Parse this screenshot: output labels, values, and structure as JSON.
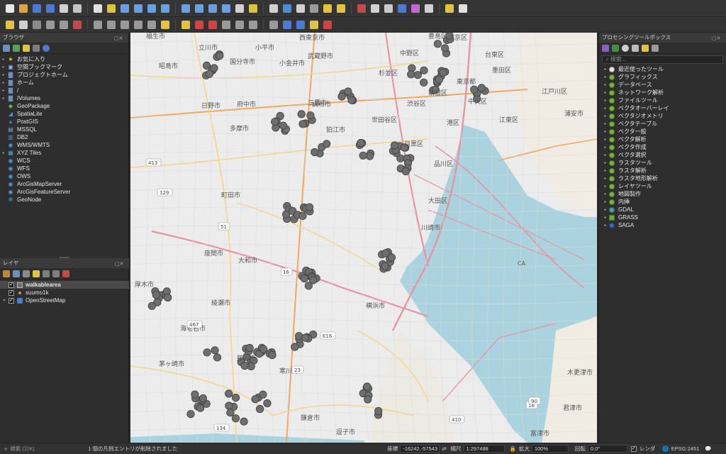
{
  "toolbar_row1": [
    "new-project-icon",
    "open-project-icon",
    "save-project-icon",
    "save-as-icon",
    "print-layout-icon",
    "style-manager-icon",
    "pan-icon",
    "pan-to-selection-icon",
    "zoom-in-icon",
    "zoom-out-icon",
    "zoom-full-icon",
    "zoom-to-selection-icon",
    "zoom-to-layer-icon",
    "zoom-native-icon",
    "zoom-last-icon",
    "zoom-next-icon",
    "new-map-view-icon",
    "new-bookmark-icon",
    "show-bookmarks-icon",
    "refresh-icon",
    "identify-icon",
    "measure-icon",
    "select-features-icon",
    "select-by-value-icon",
    "deselect-icon",
    "attribute-table-icon",
    "field-calculator-icon",
    "processing-toolbox-icon",
    "statistics-icon",
    "measure-line-icon",
    "annotation-icon",
    "text-annotation-icon"
  ],
  "toolbar_row2": [
    "digitize-icon",
    "edit-pencil-icon",
    "save-edits-icon",
    "add-feature-icon",
    "vertex-tool-icon",
    "delete-selected-icon",
    "cut-features-icon",
    "copy-features-icon",
    "paste-features-icon",
    "undo-icon",
    "redo-icon",
    "label-icon",
    "layer-labeling-icon",
    "highlight-pinned-icon",
    "pin-labels-icon",
    "show-hide-labels-icon",
    "move-label-icon",
    "rotate-label-icon",
    "change-label-icon",
    "layer-diagram-icon",
    "help-icon",
    "python-console-icon",
    "plugin-icon"
  ],
  "browser": {
    "title": "ブラウザ",
    "items": [
      {
        "label": "お気に入り",
        "icon": "star-icon",
        "expandable": true
      },
      {
        "label": "空間ブックマーク",
        "icon": "bookmark-icon",
        "expandable": true
      },
      {
        "label": "プロジェクトホーム",
        "icon": "folder-icon",
        "expandable": true
      },
      {
        "label": "ホーム",
        "icon": "folder-icon",
        "expandable": true
      },
      {
        "label": "/",
        "icon": "folder-icon",
        "expandable": true
      },
      {
        "label": "/Volumes",
        "icon": "folder-icon",
        "expandable": true
      },
      {
        "label": "GeoPackage",
        "icon": "geopackage-icon",
        "expandable": false
      },
      {
        "label": "SpatiaLite",
        "icon": "spatialite-icon",
        "expandable": false
      },
      {
        "label": "PostGIS",
        "icon": "postgis-icon",
        "expandable": false
      },
      {
        "label": "MSSQL",
        "icon": "mssql-icon",
        "expandable": false
      },
      {
        "label": "DB2",
        "icon": "db2-icon",
        "expandable": false
      },
      {
        "label": "WMS/WMTS",
        "icon": "wms-icon",
        "expandable": false
      },
      {
        "label": "XYZ Tiles",
        "icon": "xyz-tiles-icon",
        "expandable": true
      },
      {
        "label": "WCS",
        "icon": "wcs-icon",
        "expandable": false
      },
      {
        "label": "WFS",
        "icon": "wfs-icon",
        "expandable": false
      },
      {
        "label": "OWS",
        "icon": "ows-icon",
        "expandable": false
      },
      {
        "label": "ArcGisMapServer",
        "icon": "arcgis-icon",
        "expandable": false
      },
      {
        "label": "ArcGisFeatureServer",
        "icon": "arcgis-icon",
        "expandable": false
      },
      {
        "label": "GeoNode",
        "icon": "geonode-icon",
        "expandable": false
      }
    ]
  },
  "layers": {
    "title": "レイヤ",
    "items": [
      {
        "label": "walkablearea",
        "checked": true,
        "selected": true
      },
      {
        "label": "suumo1k",
        "checked": true,
        "selected": false
      },
      {
        "label": "OpenStreetMap",
        "checked": true,
        "selected": false
      }
    ]
  },
  "processing": {
    "title": "プロセシングツールボックス",
    "search_placeholder": "検索...",
    "items": [
      "最近使ったツール",
      "グラフィックス",
      "データベース",
      "ネットワーク解析",
      "ファイルツール",
      "ベクタオーバーレイ",
      "ベクタジオメトリ",
      "ベクタテーブル",
      "ベクタ一般",
      "ベクタ解析",
      "ベクタ作成",
      "ベクタ選択",
      "ラスタツール",
      "ラスタ解析",
      "ラスタ地形解析",
      "レイヤツール",
      "地図製作",
      "内挿",
      "GDAL",
      "GRASS",
      "SAGA"
    ]
  },
  "map": {
    "place_labels": [
      "福生市",
      "立川市",
      "小平市",
      "西東京市",
      "豊島区",
      "文京区",
      "昭島市",
      "国分寺市",
      "小金井市",
      "武蔵野市",
      "中野区",
      "台東区",
      "杉並区",
      "墨田区",
      "三鷹市",
      "新宿区",
      "東京都",
      "江戸川区",
      "日野市",
      "府中市",
      "調布市",
      "渋谷区",
      "中央区",
      "浦安市",
      "多摩市",
      "世田谷区",
      "江東区",
      "狛江市",
      "目黒区",
      "港区",
      "品川区",
      "町田市",
      "大田区",
      "川崎市",
      "座間市",
      "大和市",
      "厚木市",
      "綾瀬市",
      "横浜市",
      "海老名市",
      "藤沢市",
      "茅ヶ崎市",
      "鎌倉市",
      "逗子市",
      "木更津市",
      "君津市",
      "富津市",
      "寒川町"
    ],
    "road_numbers": [
      "413",
      "129",
      "51",
      "16",
      "467",
      "E16",
      "23",
      "134",
      "410",
      "16",
      "90"
    ],
    "ca_label": "CA"
  },
  "status": {
    "search_placeholder": "検索 (⌘K)",
    "message": "1 個の凡例エントリが削除されました",
    "coordinate_label": "座標",
    "coordinate_value": "-16242,-57543",
    "scale_label": "縮尺",
    "scale_value": "1:297488",
    "magnifier_label": "拡大",
    "magnifier_value": "100%",
    "rotation_label": "回転",
    "rotation_value": "0.0°",
    "render_label": "レンダ",
    "crs": "EPSG:2451"
  }
}
